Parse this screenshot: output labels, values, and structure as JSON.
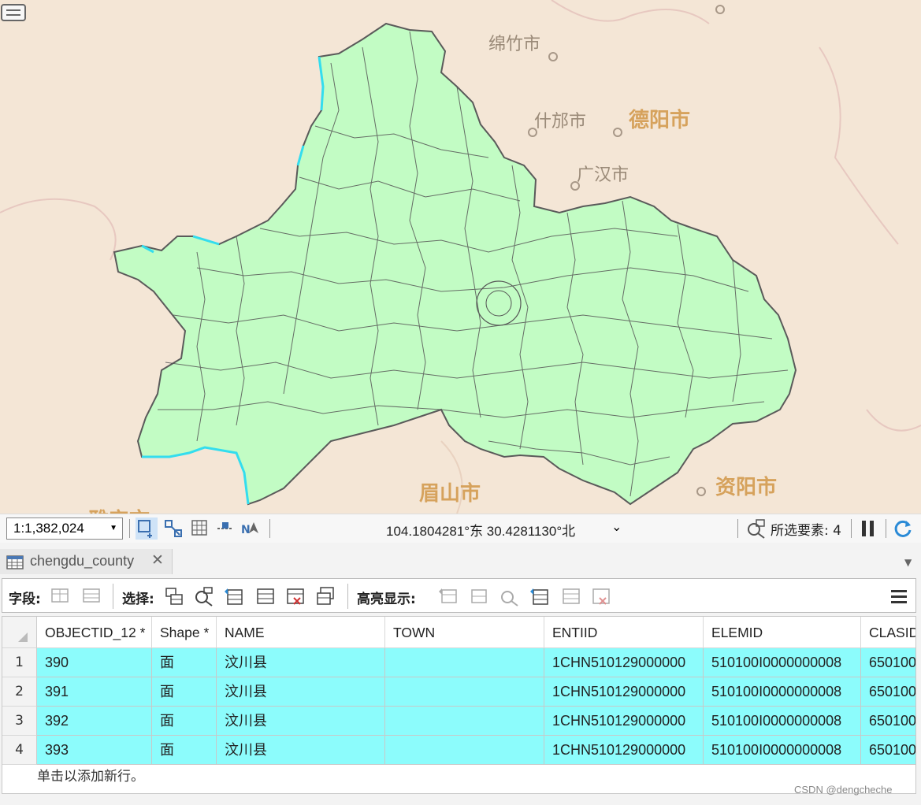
{
  "map": {
    "cities": {
      "mianzhu": "绵竹市",
      "shifang": "什邡市",
      "deyang": "德阳市",
      "guanghan": "广汉市",
      "meishan": "眉山市",
      "ziyang": "资阳市",
      "yaan_partial": "雅安市"
    },
    "land_color": "#f4e6d6",
    "region_fill": "#c2fcc4",
    "selection_color": "#33ddee"
  },
  "statusbar": {
    "scale": "1:1,382,024",
    "coordinates": "104.1804281°东 30.4281130°北",
    "selected_features": "所选要素: 4"
  },
  "tab": {
    "title": "chengdu_county",
    "close": "✕"
  },
  "toolbar": {
    "field_label": "字段:",
    "select_label": "选择:",
    "highlight_label": "高亮显示:"
  },
  "table": {
    "columns": [
      "OBJECTID_12 *",
      "Shape *",
      "NAME",
      "TOWN",
      "ENTIID",
      "ELEMID",
      "CLASID"
    ],
    "rows": [
      {
        "num": "1",
        "cells": [
          "390",
          "面",
          "汶川县",
          "",
          "1CHN510129000000",
          "510100I0000000008",
          "650100"
        ]
      },
      {
        "num": "2",
        "cells": [
          "391",
          "面",
          "汶川县",
          "",
          "1CHN510129000000",
          "510100I0000000008",
          "650100"
        ]
      },
      {
        "num": "3",
        "cells": [
          "392",
          "面",
          "汶川县",
          "",
          "1CHN510129000000",
          "510100I0000000008",
          "650100"
        ]
      },
      {
        "num": "4",
        "cells": [
          "393",
          "面",
          "汶川县",
          "",
          "1CHN510129000000",
          "510100I0000000008",
          "650100"
        ]
      }
    ],
    "add_row": "单击以添加新行。"
  },
  "watermark": "CSDN @dengcheche"
}
